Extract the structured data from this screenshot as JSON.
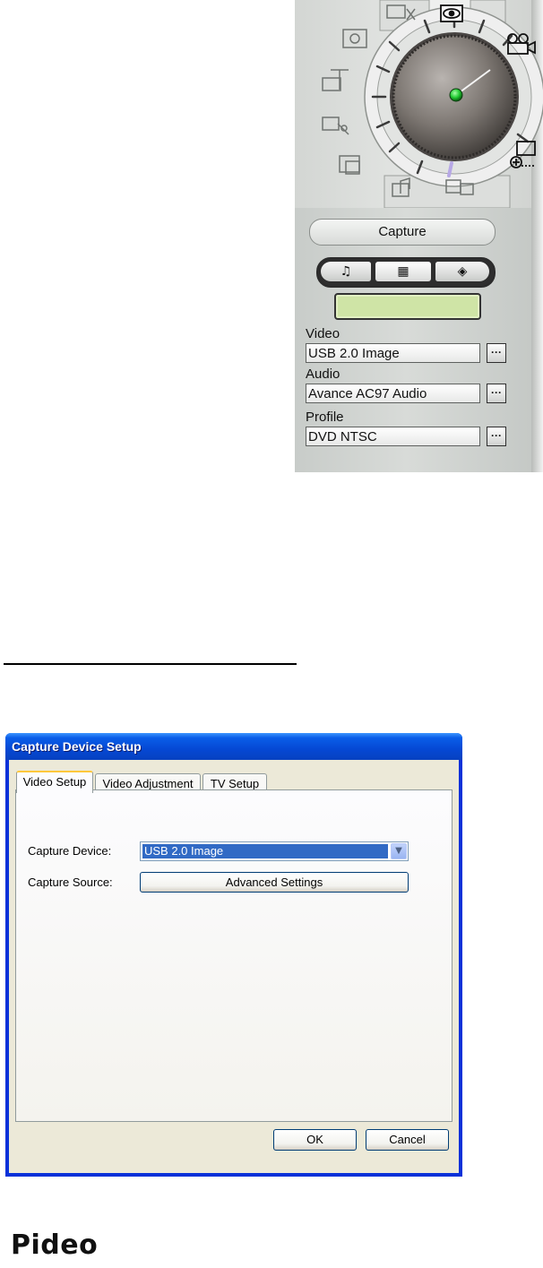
{
  "capture_panel": {
    "mode_title": "Capture",
    "mode_buttons": [
      {
        "name": "audio",
        "glyph": "♫"
      },
      {
        "name": "video",
        "glyph": "▦"
      },
      {
        "name": "disc",
        "glyph": "◈"
      }
    ],
    "video_label": "Video",
    "video_value": "USB 2.0 Image",
    "audio_label": "Audio",
    "audio_value": "Avance AC97 Audio",
    "profile_label": "Profile",
    "profile_value": "DVD NTSC",
    "browse_label": "···",
    "dial_indicator_color": "#22cc33"
  },
  "dialog": {
    "title": "Capture Device Setup",
    "tabs": [
      "Video Setup",
      "Video Adjustment",
      "TV Setup"
    ],
    "active_tab": "Video Setup",
    "capture_device_label": "Capture Device:",
    "capture_device_value": "USB 2.0 Image",
    "capture_source_label": "Capture Source:",
    "advanced_settings_label": "Advanced Settings",
    "ok_label": "OK",
    "cancel_label": "Cancel",
    "title_color": "#0548d4"
  },
  "footer": {
    "logo_text": "Pideo"
  }
}
